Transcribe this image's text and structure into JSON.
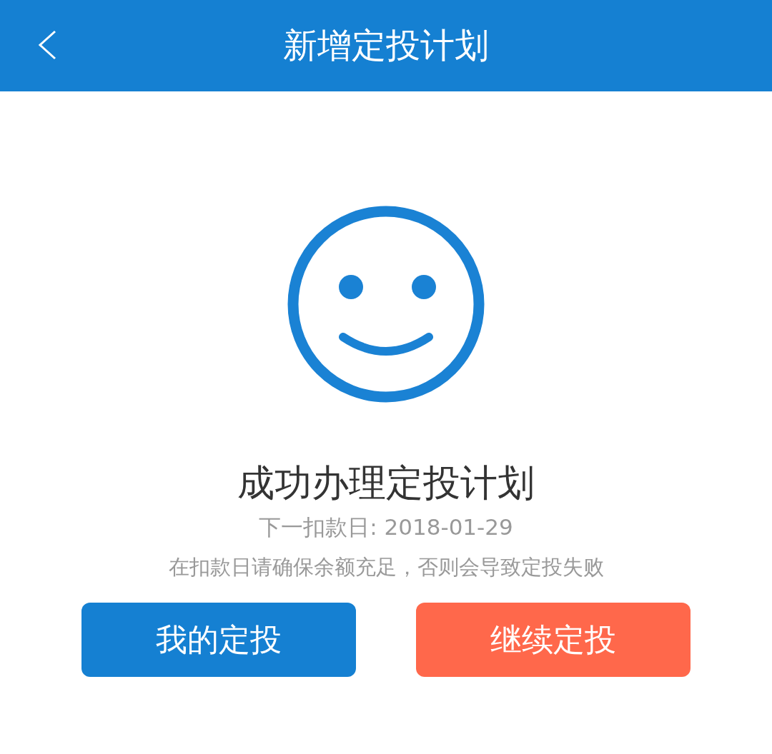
{
  "header": {
    "title": "新增定投计划"
  },
  "result": {
    "title": "成功办理定投计划",
    "next_date": "下一扣款日: 2018-01-29",
    "note": "在扣款日请确保余额充足，否则会导致定投失败"
  },
  "buttons": [
    {
      "label": "我的定投",
      "color": "#1580d2"
    },
    {
      "label": "继续定投",
      "color": "#ff684b"
    }
  ]
}
